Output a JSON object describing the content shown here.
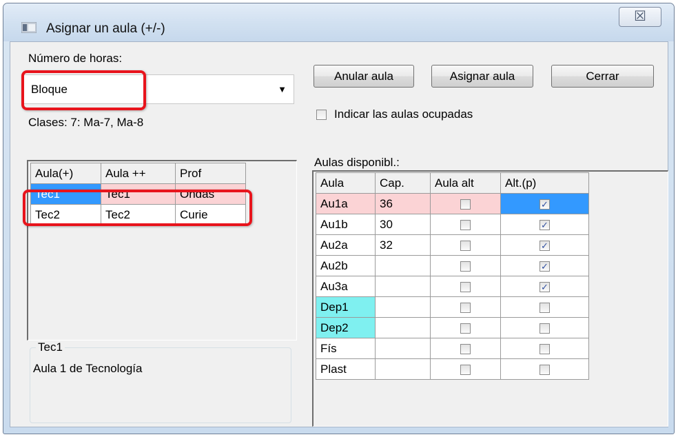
{
  "window": {
    "title": "Asignar un aula (+/-)",
    "close_symbol": "☒"
  },
  "left": {
    "hours_label": "Número de horas:",
    "hours_value": "Bloque",
    "classes_text": "Clases: 7: Ma-7, Ma-8",
    "grid": {
      "headers": [
        "Aula(+)",
        "Aula ++",
        "Prof"
      ],
      "rows": [
        [
          "Tec1",
          "Tec1",
          "Ondas"
        ],
        [
          "Tec2",
          "Tec2",
          "Curie"
        ]
      ]
    },
    "info_title": "Tec1",
    "info_text": "Aula 1 de Tecnología"
  },
  "right": {
    "buttons": {
      "anular": "Anular aula",
      "asignar": "Asignar aula",
      "cerrar": "Cerrar"
    },
    "occupied_label": "Indicar las aulas ocupadas",
    "available_label": "Aulas disponibl.:",
    "table": {
      "headers": [
        "Aula",
        "Cap.",
        "Aula alt",
        "Alt.(p)"
      ],
      "rows": [
        {
          "aula": "Au1a",
          "cap": "36",
          "aula_alt": false,
          "alt_p": true
        },
        {
          "aula": "Au1b",
          "cap": "30",
          "aula_alt": false,
          "alt_p": true
        },
        {
          "aula": "Au2a",
          "cap": "32",
          "aula_alt": false,
          "alt_p": true
        },
        {
          "aula": "Au2b",
          "cap": "",
          "aula_alt": false,
          "alt_p": true
        },
        {
          "aula": "Au3a",
          "cap": "",
          "aula_alt": false,
          "alt_p": true
        },
        {
          "aula": "Dep1",
          "cap": "",
          "aula_alt": false,
          "alt_p": false
        },
        {
          "aula": "Dep2",
          "cap": "",
          "aula_alt": false,
          "alt_p": false
        },
        {
          "aula": "Fís",
          "cap": "",
          "aula_alt": false,
          "alt_p": false
        },
        {
          "aula": "Plast",
          "cap": "",
          "aula_alt": false,
          "alt_p": false
        }
      ]
    }
  },
  "colors": {
    "selection_blue": "#3399ff",
    "row_pink": "#fbd3d5",
    "cyan_room": "#7ff0f0",
    "highlight_red": "#e8141c"
  }
}
